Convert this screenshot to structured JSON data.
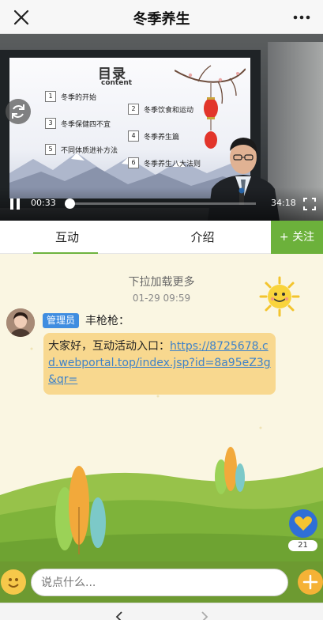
{
  "window": {
    "title": "冬季养生",
    "close_icon": "close-icon",
    "more_icon": "more-icon"
  },
  "video": {
    "slide": {
      "title": "目录",
      "subtitle": "content",
      "items": [
        {
          "num": "1",
          "text": "冬季的开始"
        },
        {
          "num": "2",
          "text": "冬季饮食和运动"
        },
        {
          "num": "3",
          "text": "冬季保健四不宜"
        },
        {
          "num": "4",
          "text": "冬季养生篇"
        },
        {
          "num": "5",
          "text": "不同体质进补方法"
        },
        {
          "num": "6",
          "text": "冬季养生八大法则"
        }
      ]
    },
    "current_time": "00:33",
    "total_time": "34:18",
    "progress_fraction": 0.016
  },
  "tabs": [
    {
      "label": "互动",
      "active": true
    },
    {
      "label": "介绍",
      "active": false
    }
  ],
  "follow_label": "+ 关注",
  "chat": {
    "load_more": "下拉加载更多",
    "timestamp": "01-29 09:59",
    "messages": [
      {
        "badge": "管理员",
        "sender": "丰枪枪：",
        "text_prefix": "大家好，互动活动入口：",
        "link": "https://8725678.cd.webportal.top/index.jsp?id=8a95eZ3g&qr="
      }
    ]
  },
  "like_count": "21",
  "input": {
    "placeholder": "说点什么..."
  },
  "colors": {
    "accent_green": "#6cb13b",
    "bubble": "#f8d88f",
    "badge_blue": "#3f8de0",
    "link": "#3f82c8"
  }
}
